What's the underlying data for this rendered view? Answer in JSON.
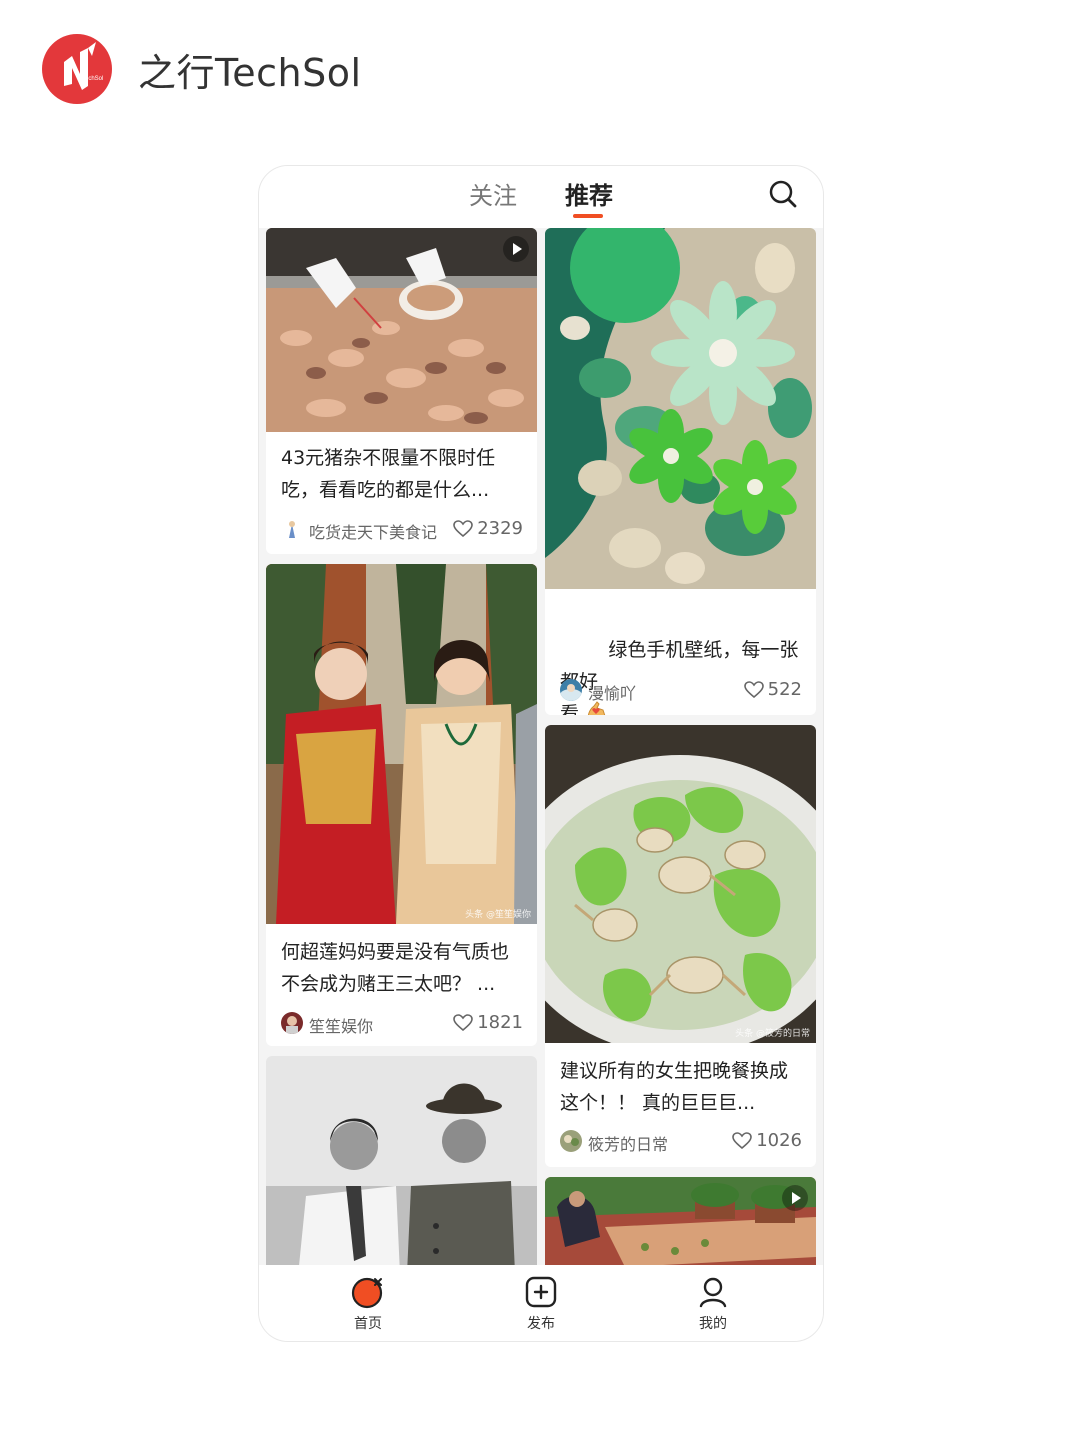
{
  "brand": {
    "name": "之行TechSol",
    "logo_text": "TechSol",
    "logo_color": "#e3383b"
  },
  "app": {
    "tabs": [
      {
        "label": "关注",
        "active": false
      },
      {
        "label": "推荐",
        "active": true
      }
    ],
    "accent_color": "#f04e23",
    "search_icon": "search-icon"
  },
  "feed": {
    "left": [
      {
        "title": "43元猪杂不限量不限时任\n吃，看看吃的都是什么...",
        "author": "吃货走天下美食记",
        "likes": "2329",
        "image": "food-stall-photo",
        "video": true
      },
      {
        "title": "何超莲妈妈要是没有气质也\n不会成为赌王三太吧？ ...",
        "author": "笙笙娱你",
        "likes": "1821",
        "image": "wedding-dress-photo",
        "watermark": "头条 @笙笙娱你"
      },
      {
        "title": "",
        "author": "",
        "likes": "",
        "image": "old-bw-photo"
      }
    ],
    "right": [
      {
        "title": "绿色手机壁纸，每一张都好\n看 ",
        "author": "漫愉吖",
        "likes": "522",
        "image": "green-flower-wallpaper"
      },
      {
        "title": "建议所有的女生把晚餐换成\n这个！！ 真的巨巨巨...",
        "author": "筱芳的日常",
        "likes": "1026",
        "image": "soup-photo",
        "watermark": "头条 @筱芳的日常"
      },
      {
        "title": "",
        "author": "",
        "likes": "",
        "image": "garden-photo",
        "video": true
      }
    ]
  },
  "bottom_nav": [
    {
      "label": "首页",
      "icon": "home-icon",
      "active": true
    },
    {
      "label": "发布",
      "icon": "publish-plus-icon",
      "active": false
    },
    {
      "label": "我的",
      "icon": "profile-icon",
      "active": false
    }
  ]
}
